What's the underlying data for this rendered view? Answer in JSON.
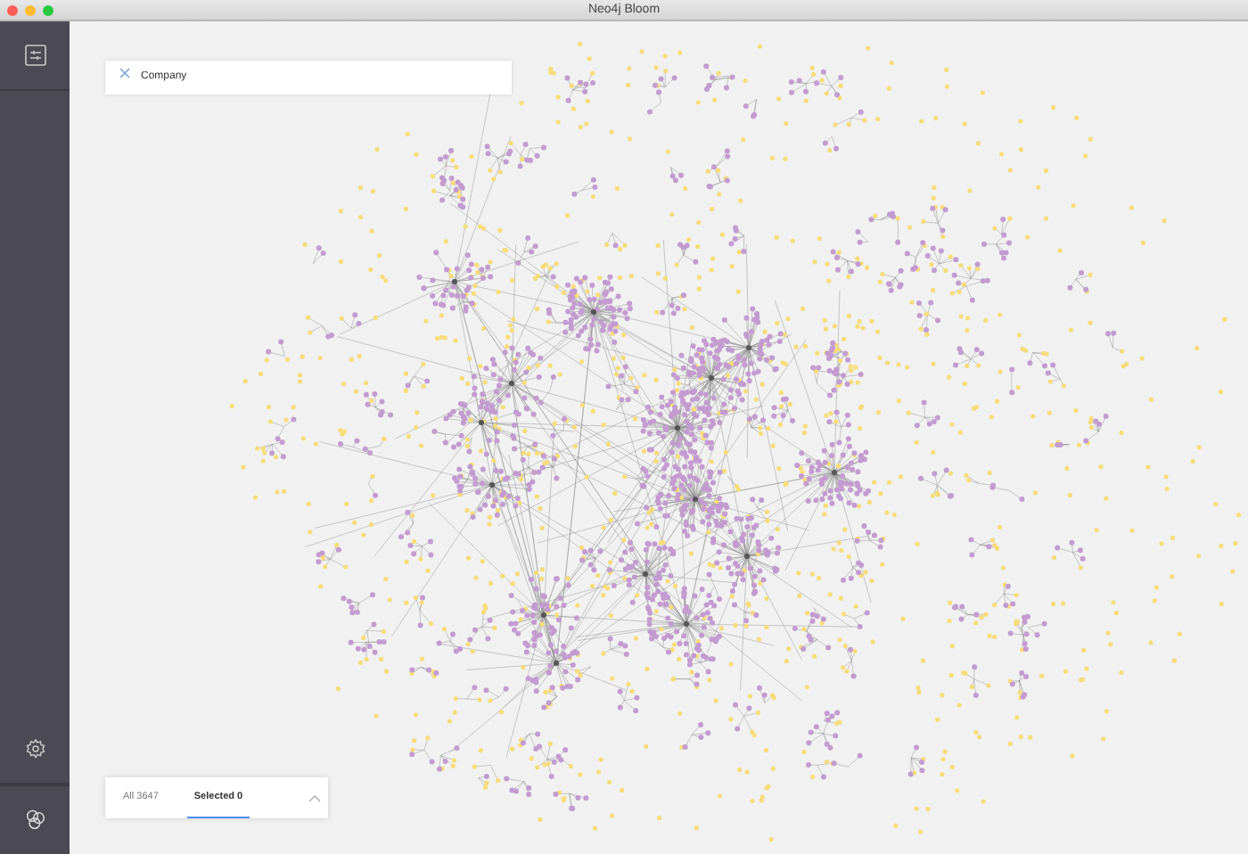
{
  "window": {
    "title": "Neo4j Bloom"
  },
  "search": {
    "value": "Company"
  },
  "result_tabs": [
    {
      "label": "All 3647",
      "selected": false
    },
    {
      "label": "Selected 0",
      "selected": true
    }
  ]
}
